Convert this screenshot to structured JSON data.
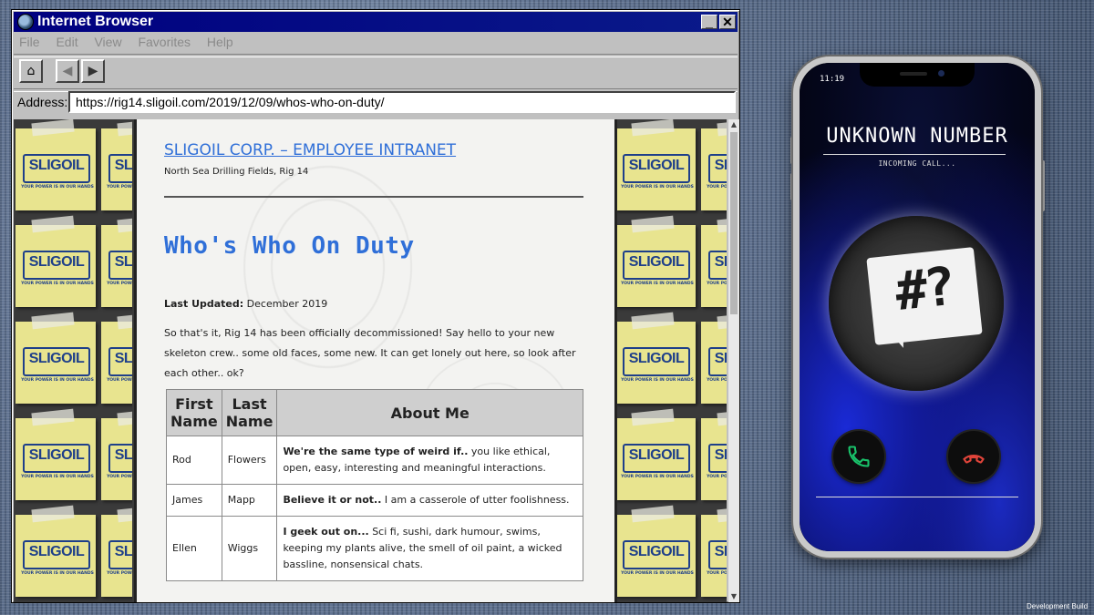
{
  "browser": {
    "title": "Internet Browser",
    "controls": {
      "minimize": "_",
      "close": "✕"
    },
    "menu": [
      "File",
      "Edit",
      "View",
      "Favorites",
      "Help"
    ],
    "toolbar": {
      "home_icon": "⌂",
      "back_icon": "◀",
      "forward_icon": "▶"
    },
    "address": {
      "label": "Address:",
      "value": "https://rig14.sligoil.com/2019/12/09/whos-who-on-duty/"
    }
  },
  "tiles": {
    "logo": "SLIGOIL",
    "tagline": "YOUR POWER IS IN OUR HANDS"
  },
  "page": {
    "site_title": "SLIGOIL CORP. – EMPLOYEE INTRANET",
    "site_subtitle": "North Sea Drilling Fields, Rig 14",
    "heading": "Who's Who On Duty",
    "updated_label": "Last Updated:",
    "updated_value": "December 2019",
    "intro": "So that's it, Rig 14 has been officially decommissioned! Say hello to your new skeleton crew.. some old faces, some new. It can get lonely out here, so look after each other.. ok?",
    "table": {
      "headers": [
        "First Name",
        "Last Name",
        "About Me"
      ],
      "rows": [
        {
          "first": "Rod",
          "last": "Flowers",
          "about_lead": "We're the same type of weird if..",
          "about_rest": " you like ethical, open, easy, interesting and meaningful interactions."
        },
        {
          "first": "James",
          "last": "Mapp",
          "about_lead": "Believe it or not..",
          "about_rest": " I am a casserole of utter foolishness."
        },
        {
          "first": "Ellen",
          "last": "Wiggs",
          "about_lead": "I geek out on...",
          "about_rest": " Sci fi, sushi, dark humour, swims, keeping my plants alive, the smell of oil paint, a wicked bassline, nonsensical chats."
        }
      ]
    }
  },
  "scrollbar": {
    "up": "▲",
    "down": "▼"
  },
  "phone": {
    "time": "11:19",
    "caller": "UNKNOWN NUMBER",
    "status": "INCOMING CALL...",
    "avatar_text": "#?",
    "accept_color": "#19c36b",
    "decline_color": "#e0443a"
  },
  "footer": {
    "build": "Development Build"
  }
}
